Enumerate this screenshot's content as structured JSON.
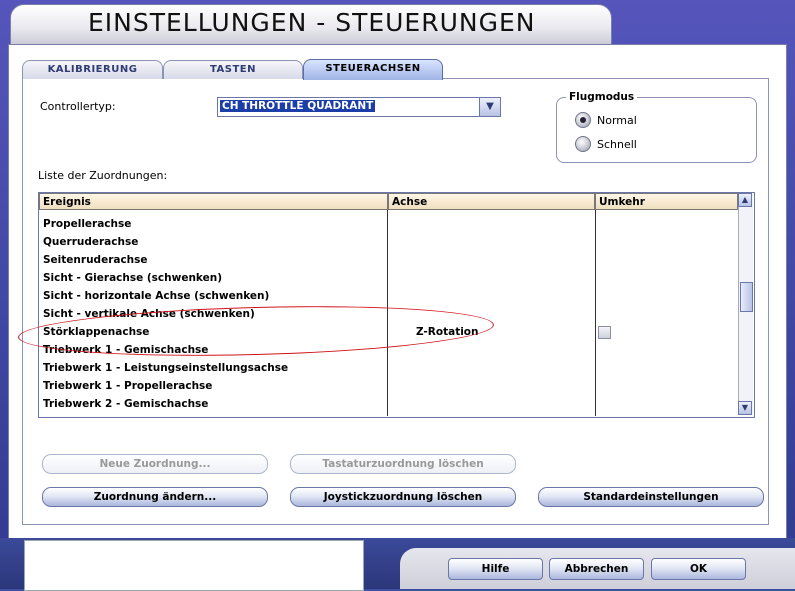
{
  "window": {
    "title": "EINSTELLUNGEN - STEUERUNGEN"
  },
  "tabs": [
    {
      "label": "KALIBRIERUNG"
    },
    {
      "label": "TASTEN"
    },
    {
      "label": "STEUERACHSEN",
      "active": true
    }
  ],
  "controller": {
    "label": "Controllertyp:",
    "value": "CH THROTTLE QUADRANT"
  },
  "flugmodus": {
    "title": "Flugmodus",
    "options": [
      {
        "label": "Normal",
        "selected": true
      },
      {
        "label": "Schnell",
        "selected": false
      }
    ]
  },
  "mappings": {
    "label": "Liste der Zuordnungen:",
    "columns": [
      "Ereignis",
      "Achse",
      "Umkehr"
    ],
    "rows": [
      {
        "event": "Propellerachse",
        "axis": "",
        "reverse": null
      },
      {
        "event": "Querruderachse",
        "axis": "",
        "reverse": null
      },
      {
        "event": "Seitenruderachse",
        "axis": "",
        "reverse": null
      },
      {
        "event": "Sicht - Gierachse (schwenken)",
        "axis": "",
        "reverse": null
      },
      {
        "event": "Sicht - horizontale Achse (schwenken)",
        "axis": "",
        "reverse": null
      },
      {
        "event": "Sicht - vertikale Achse (schwenken)",
        "axis": "",
        "reverse": null
      },
      {
        "event": "Störklappenachse",
        "axis": "Z-Rotation",
        "reverse": false
      },
      {
        "event": "Triebwerk 1 - Gemischachse",
        "axis": "",
        "reverse": null
      },
      {
        "event": "Triebwerk 1 - Leistungseinstellungsachse",
        "axis": "",
        "reverse": null
      },
      {
        "event": "Triebwerk 1 - Propellerachse",
        "axis": "",
        "reverse": null
      },
      {
        "event": "Triebwerk 2 - Gemischachse",
        "axis": "",
        "reverse": null
      }
    ]
  },
  "buttons": {
    "new_mapping": "Neue Zuordnung...",
    "delete_keyboard": "Tastaturzuordnung löschen",
    "change_mapping": "Zuordnung ändern...",
    "delete_joystick": "Joystickzuordnung löschen",
    "defaults": "Standardeinstellungen",
    "help": "Hilfe",
    "cancel": "Abbrechen",
    "ok": "OK"
  },
  "colors": {
    "accent": "#1b3ea8",
    "annotation": "#d0131b",
    "header_bg": "#f0dfbf"
  }
}
